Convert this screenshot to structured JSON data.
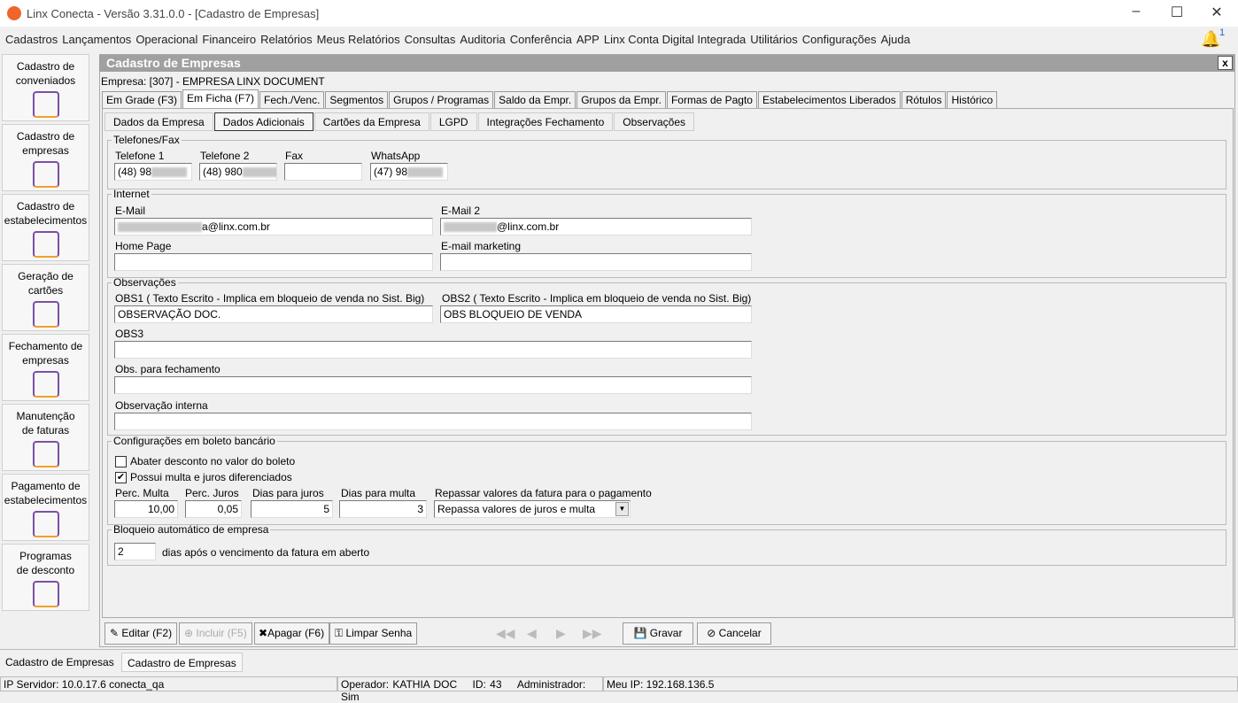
{
  "window": {
    "title": "Linx Conecta - Versão 3.31.0.0 - [Cadastro de Empresas]"
  },
  "menu": [
    "Cadastros",
    "Lançamentos",
    "Operacional",
    "Financeiro",
    "Relatórios",
    "Meus Relatórios",
    "Consultas",
    "Auditoria",
    "Conferência",
    "APP",
    "Linx Conta Digital Integrada",
    "Utilitários",
    "Configurações",
    "Ajuda"
  ],
  "notifications": {
    "count": "1"
  },
  "sidebar": [
    {
      "l1": "Cadastro de",
      "l2": "conveniados",
      "icon": "person-icon"
    },
    {
      "l1": "Cadastro de",
      "l2": "empresas",
      "icon": "building-icon"
    },
    {
      "l1": "Cadastro de",
      "l2": "estabelecimentos",
      "icon": "store-icon"
    },
    {
      "l1": "Geração de",
      "l2": "cartões",
      "icon": "card-icon"
    },
    {
      "l1": "Fechamento de",
      "l2": "empresas",
      "icon": "invoice-icon"
    },
    {
      "l1": "Manutenção",
      "l2": "de faturas",
      "icon": "tray-icon"
    },
    {
      "l1": "Pagamento de",
      "l2": "estabelecimentos",
      "icon": "payment-icon"
    },
    {
      "l1": "Programas",
      "l2": "de desconto",
      "icon": "discount-icon"
    }
  ],
  "form": {
    "title": "Cadastro de Empresas",
    "close": "x",
    "empresa": "Empresa: [307] - EMPRESA LINX DOCUMENT",
    "tabs": [
      "Em Grade (F3)",
      "Em Ficha (F7)",
      "Fech./Venc.",
      "Segmentos",
      "Grupos / Programas",
      "Saldo da Empr.",
      "Grupos da Empr.",
      "Formas de Pagto",
      "Estabelecimentos Liberados",
      "Rótulos",
      "Histórico"
    ],
    "subtabs": [
      "Dados da Empresa",
      "Dados Adicionais",
      "Cartões da Empresa",
      "LGPD",
      "Integrações Fechamento",
      "Observações"
    ],
    "telefones": {
      "legend": "Telefones/Fax",
      "tel1_label": "Telefone 1",
      "tel1": "(48) 98",
      "tel2_label": "Telefone 2",
      "tel2": "(48) 980",
      "fax_label": "Fax",
      "fax": "",
      "whatsapp_label": "WhatsApp",
      "whatsapp": "(47) 98"
    },
    "internet": {
      "legend": "Internet",
      "email_label": "E-Mail",
      "email": "a@linx.com.br",
      "email2_label": "E-Mail 2",
      "email2": "@linx.com.br",
      "homepage_label": "Home Page",
      "homepage": "",
      "mkt_label": "E-mail marketing",
      "mkt": ""
    },
    "obs": {
      "legend": "Observações",
      "obs1_label": "OBS1 ( Texto Escrito - Implica em bloqueio de venda no Sist. Big)",
      "obs1": "OBSERVAÇÃO DOC.",
      "obs2_label": "OBS2 ( Texto Escrito - Implica em bloqueio de venda no Sist. Big)",
      "obs2": "OBS BLOQUEIO DE VENDA",
      "obs3_label": "OBS3",
      "obs3": "",
      "fech_label": "Obs. para fechamento",
      "fech": "",
      "interna_label": "Observação interna",
      "interna": ""
    },
    "boleto": {
      "legend": "Configurações em boleto bancário",
      "abater_label": "Abater desconto no valor do boleto",
      "abater": false,
      "multa_juros_label": "Possui multa e juros diferenciados",
      "multa_juros": true,
      "perc_multa_label": "Perc. Multa",
      "perc_multa": "10,00",
      "perc_juros_label": "Perc. Juros",
      "perc_juros": "0,05",
      "dias_juros_label": "Dias para juros",
      "dias_juros": "5",
      "dias_multa_label": "Dias para multa",
      "dias_multa": "3",
      "repassar_label": "Repassar valores da fatura para o pagamento",
      "repassar": "Repassa valores de juros e multa"
    },
    "bloqueio": {
      "legend": "Bloqueio automático de empresa",
      "dias": "2",
      "suffix": "dias após o vencimento da fatura em aberto"
    }
  },
  "buttons": {
    "editar": "Editar (F2)",
    "incluir": "Incluir (F5)",
    "apagar": "Apagar (F6)",
    "limpar": "Limpar Senha",
    "gravar": "Gravar",
    "cancelar": "Cancelar"
  },
  "bottom_tabs": [
    "Cadastro de Empresas",
    "Cadastro de Empresas"
  ],
  "status": {
    "servidor": "IP Servidor: 10.0.17.6 conecta_qa",
    "operador": "Operador: KATHIA DOC",
    "id": "ID: 43",
    "admin": "Administrador: Sim",
    "meu_ip": "Meu IP: 192.168.136.5"
  }
}
